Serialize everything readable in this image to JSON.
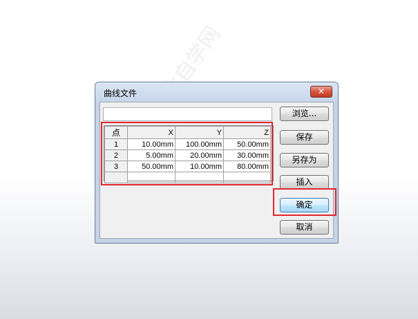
{
  "dialog": {
    "title": "曲线文件",
    "close_symbol": "✕",
    "path_value": "",
    "buttons": {
      "browse": "浏览...",
      "save": "保存",
      "save_as": "另存为",
      "insert": "插入",
      "ok": "确定",
      "cancel": "取消"
    }
  },
  "table": {
    "headers": [
      "点",
      "X",
      "Y",
      "Z"
    ],
    "rows": [
      [
        "1",
        "10.00mm",
        "100.00mm",
        "50.00mm"
      ],
      [
        "2",
        "5.00mm",
        "20.00mm",
        "30.00mm"
      ],
      [
        "3",
        "50.00mm",
        "10.00mm",
        "80.00mm"
      ],
      [
        "",
        "",
        "",
        ""
      ]
    ]
  },
  "watermark": "软件自学网",
  "colors": {
    "highlight": "#e0262f",
    "close_button": "#c23b22"
  }
}
